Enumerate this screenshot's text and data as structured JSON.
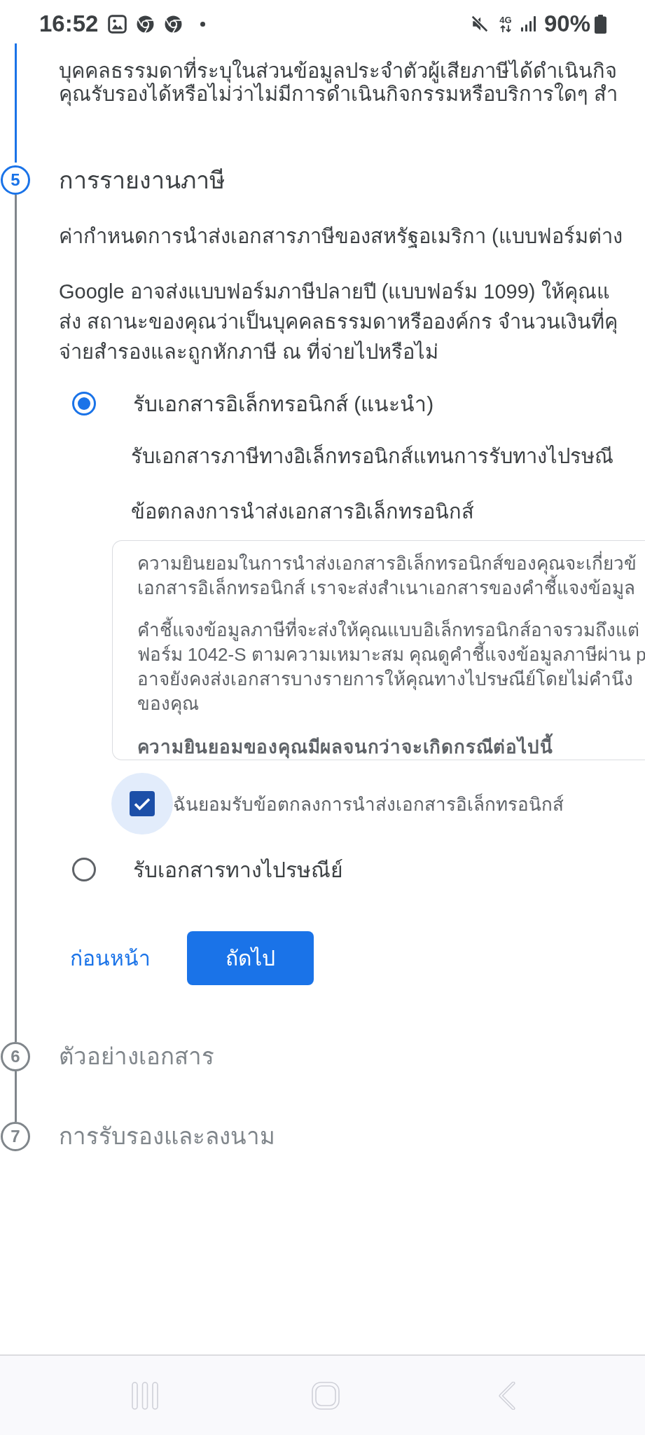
{
  "status_bar": {
    "time": "16:52",
    "network": "4G",
    "battery": "90%"
  },
  "previous_section": {
    "lines": [
      "บุคคลธรรมดาที่ระบุในส่วนข้อมูลประจำตัวผู้เสียภาษีได้ดำเนินกิจ",
      "คุณรับรองได้หรือไม่ว่าไม่มีการดำเนินกิจกรรมหรือบริการใดๆ สำ"
    ]
  },
  "steps": [
    {
      "number": "5",
      "title": "การรายงานภาษี",
      "selected": true,
      "intro": "ค่ากำหนดการนำส่งเอกสารภาษีของสหรัฐอเมริกา (แบบฟอร์มต่าง",
      "description": {
        "lines": [
          "Google อาจส่งแบบฟอร์มภาษีปลายปี (แบบฟอร์ม 1099) ให้คุณแ",
          "ส่ง สถานะของคุณว่าเป็นบุคคลธรรมดาหรือองค์กร จำนวนเงินที่คุ",
          "จ่ายสำรองและถูกหักภาษี ณ ที่จ่ายไปหรือไม่"
        ]
      },
      "options": [
        {
          "label": "รับเอกสารอิเล็กทรอนิกส์ (แนะนำ)",
          "selected": true,
          "detail": "รับเอกสารภาษีทางอิเล็กทรอนิกส์แทนการรับทางไปรษณี",
          "agreement": {
            "title": "ข้อตกลงการนำส่งเอกสารอิเล็กทรอนิกส์",
            "paragraphs": [
              {
                "kind": "text",
                "lines": [
                  "ความยินยอมในการนำส่งเอกสารอิเล็กทรอนิกส์ของคุณจะเกี่ยวข้",
                  "เอกสารอิเล็กทรอนิกส์ เราจะส่งสำเนาเอกสารของคำชี้แจงข้อมูล"
                ]
              },
              {
                "kind": "text",
                "lines": [
                  "คำชี้แจงข้อมูลภาษีที่จะส่งให้คุณแบบอิเล็กทรอนิกส์อาจรวมถึงแต่",
                  "ฟอร์ม 1042-S ตามความเหมาะสม คุณดูคำชี้แจงข้อมูลภาษีผ่าน p",
                  "อาจยังคงส่งเอกสารบางรายการให้คุณทางไปรษณีย์โดยไม่คำนึง",
                  "ของคุณ"
                ]
              },
              {
                "kind": "heading",
                "lines": [
                  "ความยินยอมของคุณมีผลจนกว่าจะเกิดกรณีต่อไปนี้"
                ]
              }
            ]
          },
          "consent": {
            "label": "ฉันยอมรับข้อตกลงการนำส่งเอกสารอิเล็กทรอนิกส์",
            "checked": true,
            "focused": true
          }
        },
        {
          "label": "รับเอกสารทางไปรษณีย์",
          "selected": false
        }
      ],
      "back": "ก่อนหน้า",
      "next": "ถัดไป"
    },
    {
      "number": "6",
      "title": "ตัวอย่างเอกสาร",
      "selected": false
    },
    {
      "number": "7",
      "title": "การรับรองและลงนาม",
      "selected": false
    }
  ]
}
